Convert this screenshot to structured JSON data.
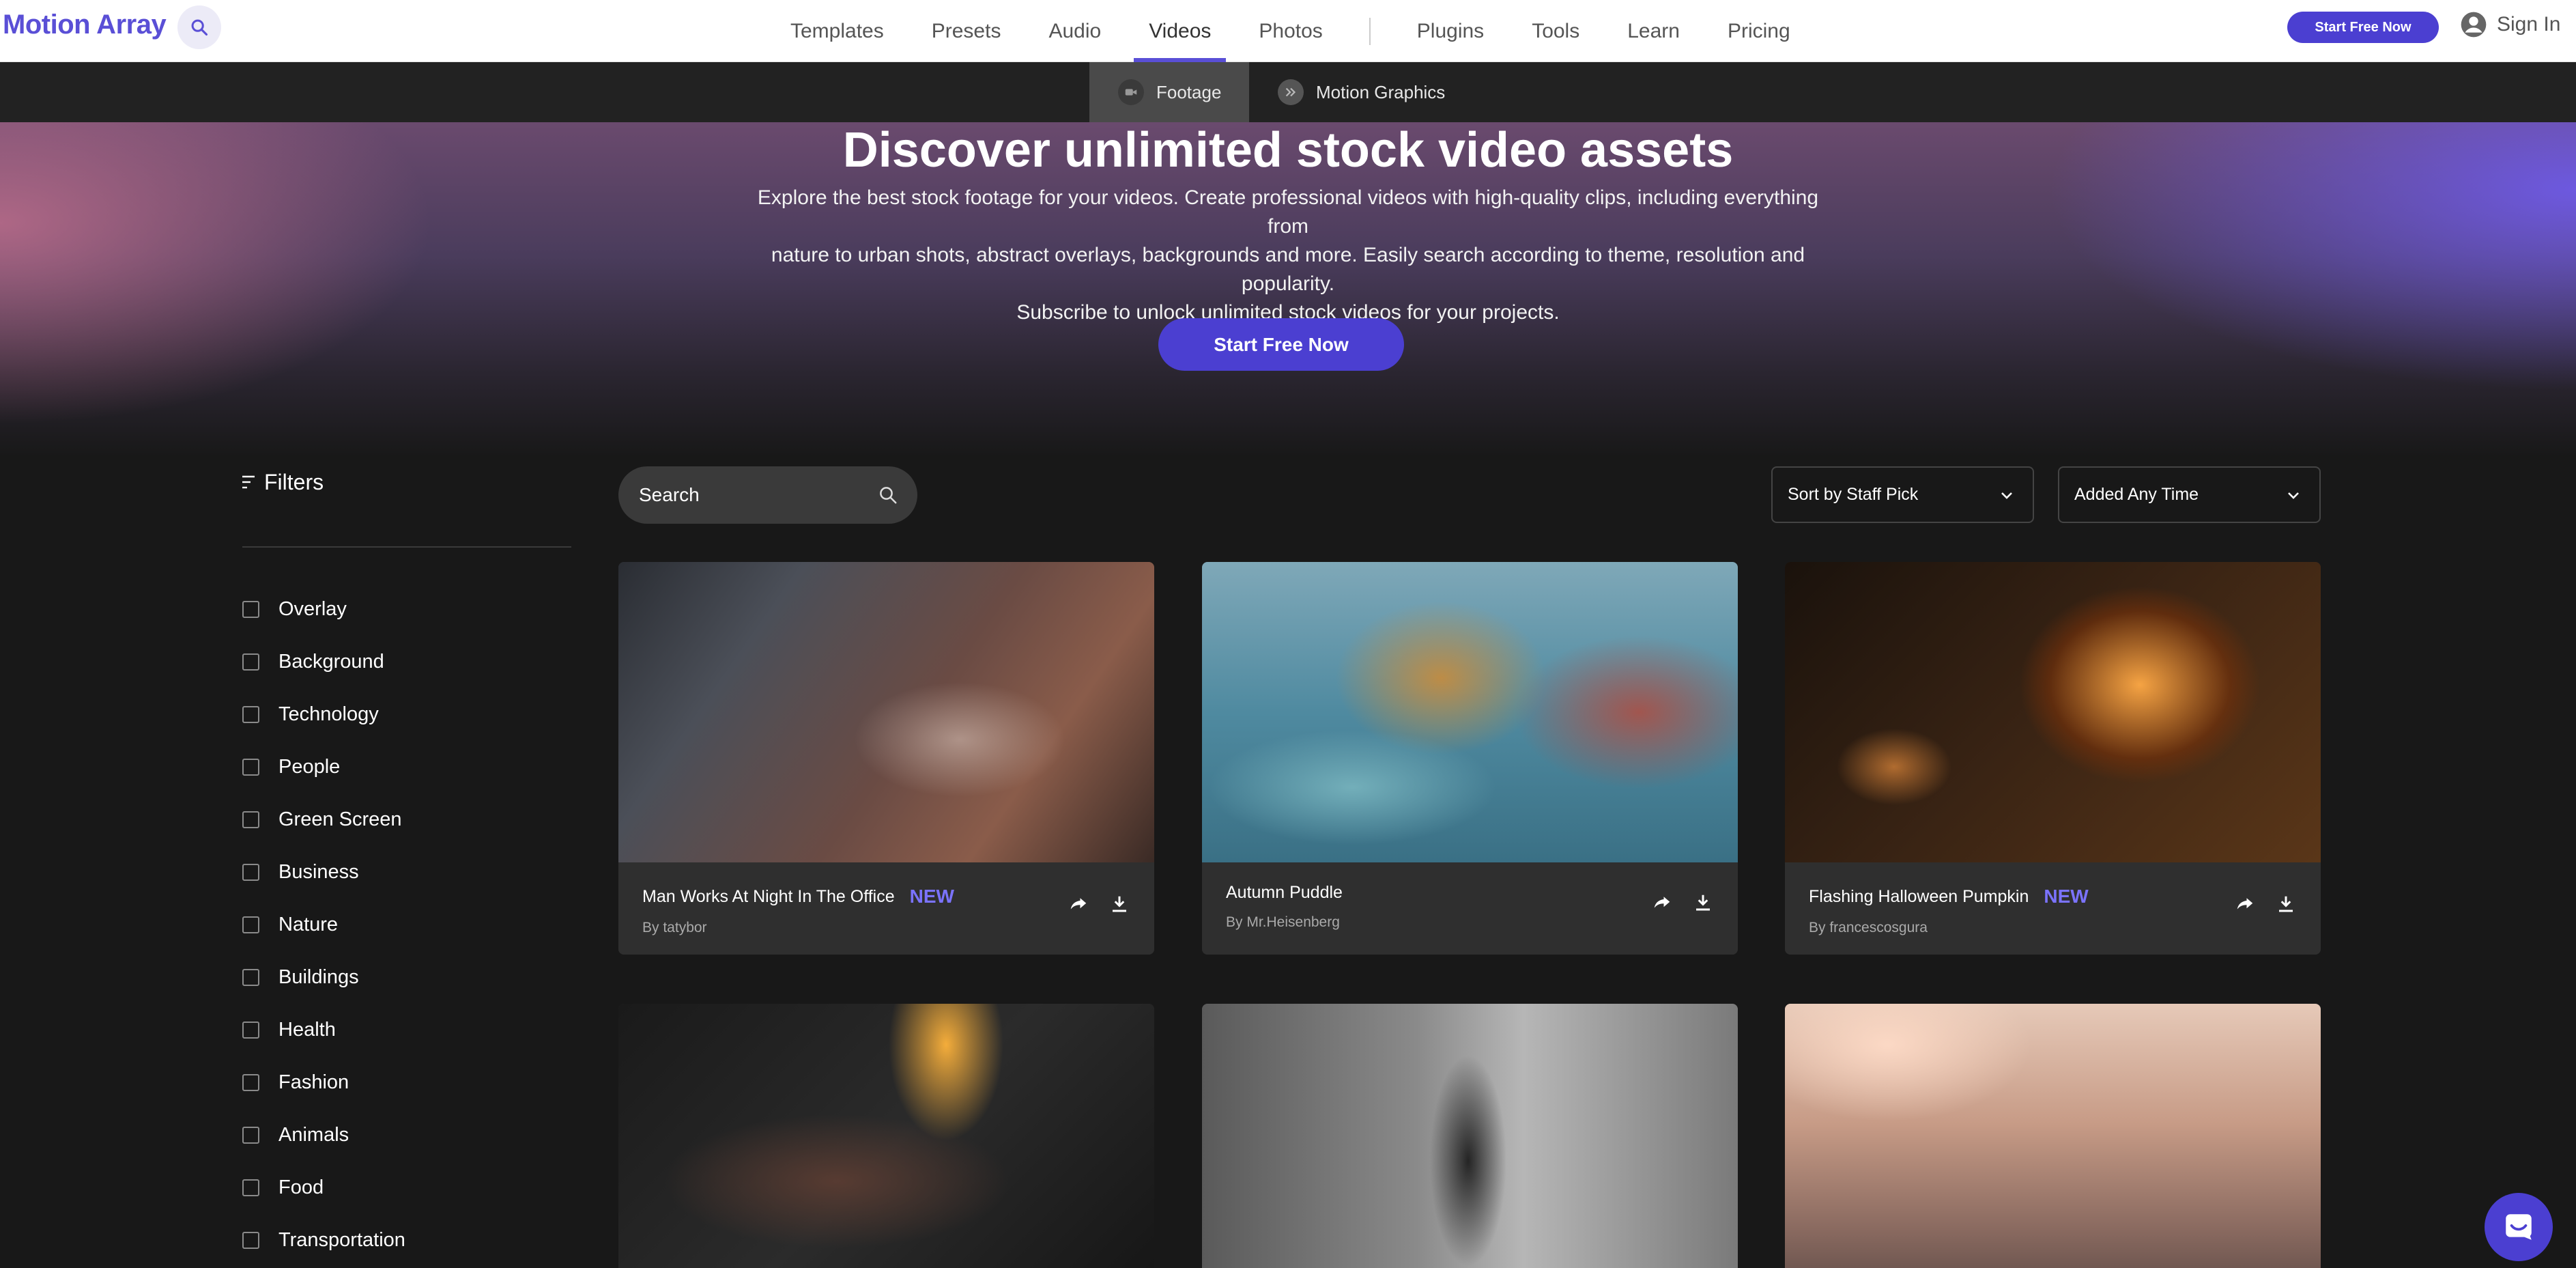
{
  "nav": {
    "logo": "Motion Array",
    "links": [
      "Templates",
      "Presets",
      "Audio",
      "Videos",
      "Photos",
      "Plugins",
      "Tools",
      "Learn",
      "Pricing"
    ],
    "active": "Videos",
    "start_label": "Start Free Now",
    "signin_label": "Sign In",
    "accent": "#4b3fd1"
  },
  "subnav": {
    "footage": "Footage",
    "motion": "Motion Graphics"
  },
  "hero": {
    "title": "Discover unlimited stock video assets",
    "line1": "Explore the best stock footage for your videos. Create professional videos with high-quality clips, including everything from",
    "line2": "nature to urban shots, abstract overlays, backgrounds and more. Easily search according to theme, resolution and popularity.",
    "line3": "Subscribe to unlock unlimited stock videos for your projects.",
    "cta": "Start Free Now"
  },
  "filters": {
    "heading": "Filters",
    "items": [
      "Overlay",
      "Background",
      "Technology",
      "People",
      "Green Screen",
      "Business",
      "Nature",
      "Buildings",
      "Health",
      "Fashion",
      "Animals",
      "Food",
      "Transportation"
    ]
  },
  "toolbar": {
    "search_placeholder": "Search",
    "sort": "Sort by Staff Pick",
    "time": "Added Any Time"
  },
  "cards": [
    {
      "title": "Man Works At Night In The Office",
      "author": "By tatybor",
      "badge": "NEW"
    },
    {
      "title": "Autumn Puddle",
      "author": "By Mr.Heisenberg",
      "badge": ""
    },
    {
      "title": "Flashing Halloween Pumpkin",
      "author": "By francescosgura",
      "badge": "NEW"
    }
  ]
}
